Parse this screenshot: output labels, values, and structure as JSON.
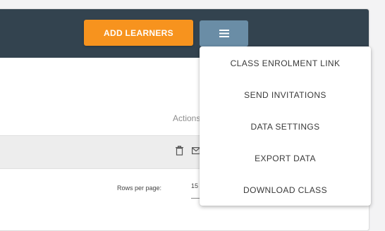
{
  "header": {
    "add_learners_label": "ADD LEARNERS",
    "menu_icon": "hamburger-menu-icon",
    "background_color": "#33434f",
    "add_button_color": "#f7931e",
    "menu_button_color": "#6a8da6"
  },
  "table": {
    "actions_header": "Actions",
    "row_icons": [
      "trash-icon",
      "mail-icon"
    ],
    "rows_per_page_label": "Rows per page:",
    "rows_per_page_value": "15"
  },
  "dropdown": {
    "items": [
      {
        "label": "CLASS ENROLMENT LINK"
      },
      {
        "label": "SEND INVITATIONS"
      },
      {
        "label": "DATA SETTINGS"
      },
      {
        "label": "EXPORT DATA"
      },
      {
        "label": "DOWNLOAD CLASS"
      }
    ]
  }
}
